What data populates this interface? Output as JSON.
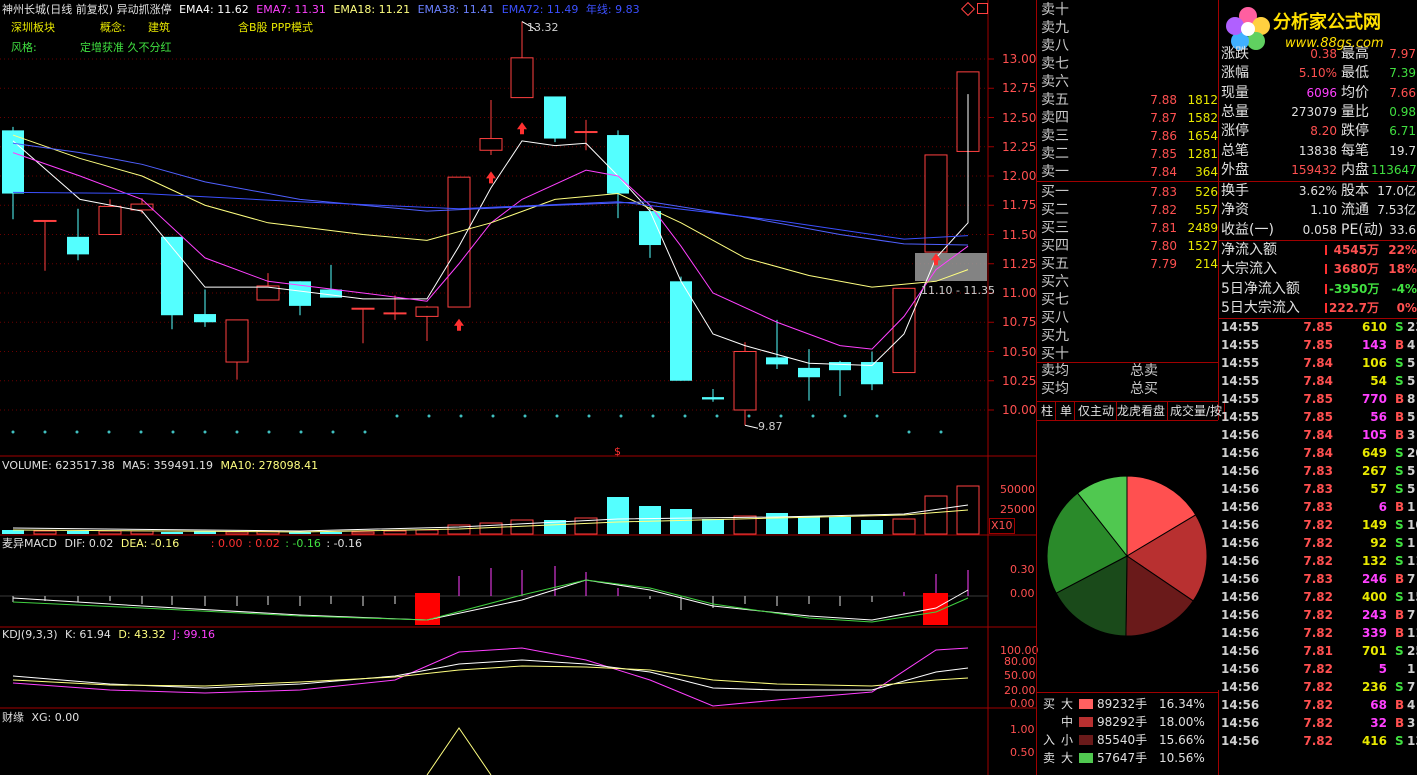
{
  "header": {
    "stock_title": "神州长城(日线 前复权)",
    "indicator_name": "异动抓涨停",
    "ema4_label": "EMA4: 11.62",
    "ema7_label": "EMA7: 11.31",
    "ema18_label": "EMA18: 11.21",
    "ema38_label": "EMA38: 11.41",
    "ema72_label": "EMA72: 11.49",
    "year_line_label": "年线: 9.83",
    "board_label": "深圳板块",
    "concept_key": "概念:",
    "concept_value": "建筑",
    "b_share": "含B股 PPP模式",
    "style_key": "风格:",
    "style_value": "定增获准 久不分红",
    "high_annot": "13.32",
    "low_annot": "9.87",
    "range_annot": "11.10 - 11.35",
    "dollar_mark": "$"
  },
  "colors": {
    "up": "#ff4040",
    "down": "#54ffff",
    "ema4": "#ffffff",
    "ema7": "#ff40ff",
    "ema18": "#ffff80",
    "ema38": "#3c50ff",
    "ema72": "#3c50ff",
    "grid": "#a00000"
  },
  "price_axis": [
    "13.00",
    "12.75",
    "12.50",
    "12.25",
    "12.00",
    "11.75",
    "11.50",
    "11.25",
    "11.00",
    "10.75",
    "10.50",
    "10.25",
    "10.00"
  ],
  "volume": {
    "label": "VOLUME: 623517.38",
    "ma5": "MA5: 359491.19",
    "ma10": "MA10: 278098.41",
    "axis": [
      "50000",
      "25000"
    ],
    "unit": "X10"
  },
  "macd": {
    "label": "麦异MACD",
    "dif": "DIF: 0.02",
    "dea": "DEA: -0.16",
    "v1": ": 0.00",
    "v2": ": 0.02",
    "v3": ": -0.16",
    "v4": ": -0.16",
    "axis": [
      "0.30",
      "0.00"
    ]
  },
  "kdj": {
    "label": "KDJ(9,3,3)",
    "k": "K: 61.94",
    "d": "D: 43.32",
    "j": "J: 99.16",
    "axis": [
      "100.00",
      "80.00",
      "50.00",
      "20.00",
      "0.00"
    ]
  },
  "xg": {
    "label": "财缘",
    "value": "XG: 0.00",
    "axis": [
      "1.00",
      "0.50"
    ]
  },
  "orderbook": {
    "sells": [
      {
        "label": "卖十",
        "price": "",
        "vol": ""
      },
      {
        "label": "卖九",
        "price": "",
        "vol": ""
      },
      {
        "label": "卖八",
        "price": "",
        "vol": ""
      },
      {
        "label": "卖七",
        "price": "",
        "vol": ""
      },
      {
        "label": "卖六",
        "price": "",
        "vol": ""
      },
      {
        "label": "卖五",
        "price": "7.88",
        "vol": "1812"
      },
      {
        "label": "卖四",
        "price": "7.87",
        "vol": "1582"
      },
      {
        "label": "卖三",
        "price": "7.86",
        "vol": "1654"
      },
      {
        "label": "卖二",
        "price": "7.85",
        "vol": "1281"
      },
      {
        "label": "卖一",
        "price": "7.84",
        "vol": "364"
      }
    ],
    "buys": [
      {
        "label": "买一",
        "price": "7.83",
        "vol": "526"
      },
      {
        "label": "买二",
        "price": "7.82",
        "vol": "557"
      },
      {
        "label": "买三",
        "price": "7.81",
        "vol": "2489"
      },
      {
        "label": "买四",
        "price": "7.80",
        "vol": "1527"
      },
      {
        "label": "买五",
        "price": "7.79",
        "vol": "214"
      },
      {
        "label": "买六",
        "price": "",
        "vol": ""
      },
      {
        "label": "买七",
        "price": "",
        "vol": ""
      },
      {
        "label": "买八",
        "price": "",
        "vol": ""
      },
      {
        "label": "买九",
        "price": "",
        "vol": ""
      },
      {
        "label": "买十",
        "price": "",
        "vol": ""
      }
    ],
    "avg_sell_label": "卖均",
    "avg_buy_label": "买均",
    "total_sell_label": "总卖",
    "total_buy_label": "总买"
  },
  "logo": {
    "text": "分析家公式网",
    "url": "www.88gs.com"
  },
  "stats": [
    {
      "k1": "涨跌",
      "v1": "0.38",
      "k2": "最高",
      "v2": "7.97"
    },
    {
      "k1": "涨幅",
      "v1": "5.10%",
      "k2": "最低",
      "v2": "7.39"
    },
    {
      "k1": "现量",
      "v1": "6096",
      "k2": "均价",
      "v2": "7.66"
    },
    {
      "k1": "总量",
      "v1": "273079",
      "k2": "量比",
      "v2": "0.98"
    },
    {
      "k1": "涨停",
      "v1": "8.20",
      "k2": "跌停",
      "v2": "6.71"
    },
    {
      "k1": "总笔",
      "v1": "13838",
      "k2": "每笔",
      "v2": "19.7"
    },
    {
      "k1": "外盘",
      "v1": "159432",
      "k2": "内盘",
      "v2": "113647"
    }
  ],
  "stats2": [
    {
      "k1": "换手",
      "v1": "3.62%",
      "k2": "股本",
      "v2": "17.0亿"
    },
    {
      "k1": "净资",
      "v1": "1.10",
      "k2": "流通",
      "v2": "7.53亿"
    },
    {
      "k1": "收益(一)",
      "v1": "0.058",
      "k2": "PE(动)",
      "v2": "33.6"
    }
  ],
  "flows": [
    {
      "k": "净流入额",
      "v": "4545万",
      "p": "22%"
    },
    {
      "k": "大宗流入",
      "v": "3680万",
      "p": "18%"
    },
    {
      "k": "5日净流入额",
      "v": "-3950万",
      "p": "-4%"
    },
    {
      "k": "5日大宗流入",
      "v": "222.7万",
      "p": "0%"
    }
  ],
  "ticks": [
    {
      "t": "14:55",
      "p": "7.85",
      "v": "610",
      "d": "S",
      "n": "23"
    },
    {
      "t": "14:55",
      "p": "7.85",
      "v": "143",
      "d": "B",
      "n": "4"
    },
    {
      "t": "14:55",
      "p": "7.84",
      "v": "106",
      "d": "S",
      "n": "5"
    },
    {
      "t": "14:55",
      "p": "7.84",
      "v": "54",
      "d": "S",
      "n": "5"
    },
    {
      "t": "14:55",
      "p": "7.85",
      "v": "770",
      "d": "B",
      "n": "8"
    },
    {
      "t": "14:55",
      "p": "7.85",
      "v": "56",
      "d": "B",
      "n": "5"
    },
    {
      "t": "14:56",
      "p": "7.84",
      "v": "105",
      "d": "B",
      "n": "3"
    },
    {
      "t": "14:56",
      "p": "7.84",
      "v": "649",
      "d": "S",
      "n": "20"
    },
    {
      "t": "14:56",
      "p": "7.83",
      "v": "267",
      "d": "S",
      "n": "5"
    },
    {
      "t": "14:56",
      "p": "7.83",
      "v": "57",
      "d": "S",
      "n": "5"
    },
    {
      "t": "14:56",
      "p": "7.83",
      "v": "6",
      "d": "B",
      "n": "1"
    },
    {
      "t": "14:56",
      "p": "7.82",
      "v": "149",
      "d": "S",
      "n": "10"
    },
    {
      "t": "14:56",
      "p": "7.82",
      "v": "92",
      "d": "S",
      "n": "1"
    },
    {
      "t": "14:56",
      "p": "7.82",
      "v": "132",
      "d": "S",
      "n": "11"
    },
    {
      "t": "14:56",
      "p": "7.83",
      "v": "246",
      "d": "B",
      "n": "7"
    },
    {
      "t": "14:56",
      "p": "7.82",
      "v": "400",
      "d": "S",
      "n": "15"
    },
    {
      "t": "14:56",
      "p": "7.82",
      "v": "243",
      "d": "B",
      "n": "7"
    },
    {
      "t": "14:56",
      "p": "7.82",
      "v": "339",
      "d": "B",
      "n": "11"
    },
    {
      "t": "14:56",
      "p": "7.81",
      "v": "701",
      "d": "S",
      "n": "25"
    },
    {
      "t": "14:56",
      "p": "7.82",
      "v": "5",
      "d": "",
      "n": "1"
    },
    {
      "t": "14:56",
      "p": "7.82",
      "v": "236",
      "d": "S",
      "n": "7"
    },
    {
      "t": "14:56",
      "p": "7.82",
      "v": "68",
      "d": "B",
      "n": "4"
    },
    {
      "t": "14:56",
      "p": "7.82",
      "v": "32",
      "d": "B",
      "n": "3"
    },
    {
      "t": "14:56",
      "p": "7.82",
      "v": "416",
      "d": "S",
      "n": "13"
    }
  ],
  "tabs": [
    "柱",
    "单",
    "仅主动",
    "龙虎看盘",
    "成交量/按"
  ],
  "pie": [
    {
      "name": "大买",
      "value": 16.34,
      "color": "#ff5050"
    },
    {
      "name": "中买",
      "value": 18.0,
      "color": "#b83030"
    },
    {
      "name": "小买",
      "value": 15.66,
      "color": "#6a1a1a"
    },
    {
      "name": "小卖",
      "value": 17.0,
      "color": "#1a4a1a"
    },
    {
      "name": "中卖",
      "value": 22.0,
      "color": "#2a8a2a"
    },
    {
      "name": "大卖",
      "value": 10.56,
      "color": "#50c850"
    }
  ],
  "buysell": [
    {
      "side": "买",
      "size": "大",
      "vol": "89232手",
      "pct": "16.34%",
      "color": "#ff6060"
    },
    {
      "side": "",
      "size": "中",
      "vol": "98292手",
      "pct": "18.00%",
      "color": "#b83030"
    },
    {
      "side": "入",
      "size": "小",
      "vol": "85540手",
      "pct": "15.66%",
      "color": "#6a1a1a"
    },
    {
      "side": "卖",
      "size": "大",
      "vol": "57647手",
      "pct": "10.56%",
      "color": "#50c850"
    }
  ]
}
